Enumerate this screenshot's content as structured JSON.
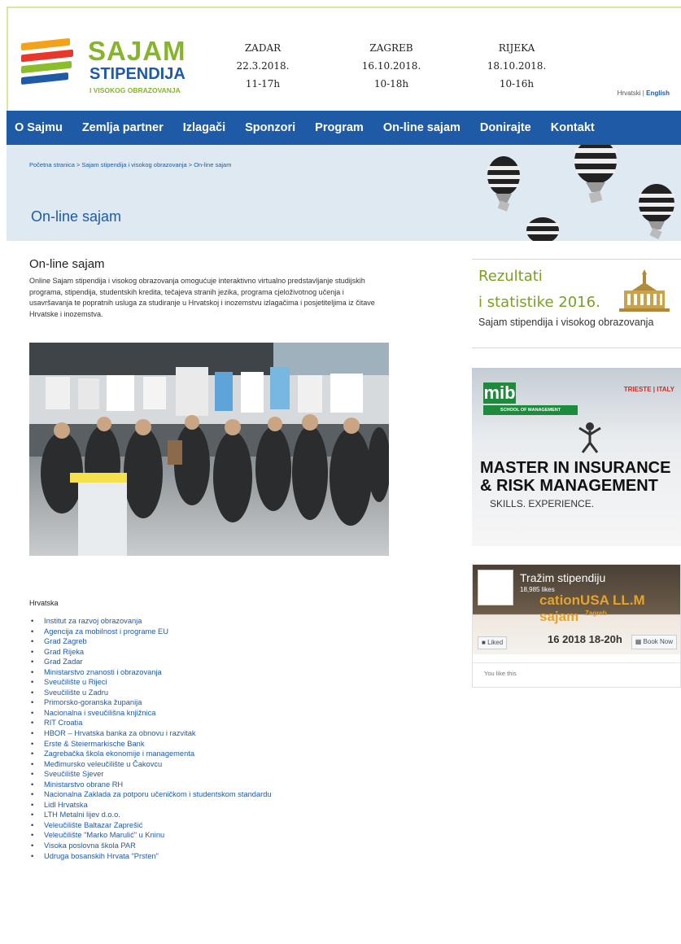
{
  "header": {
    "brand_line1": "SAJAM",
    "brand_line2": "STIPENDIJA",
    "brand_line3": "I VISOKOG OBRAZOVANJA",
    "events": [
      {
        "city": "ZADAR",
        "date": "22.3.2018.",
        "time": "11-17h"
      },
      {
        "city": "ZAGREB",
        "date": "16.10.2018.",
        "time": "10-18h"
      },
      {
        "city": "RIJEKA",
        "date": "18.10.2018.",
        "time": "10-16h"
      }
    ],
    "lang_hr": "Hrvatski",
    "lang_sep": "|",
    "lang_en": "English"
  },
  "nav": [
    "O Sajmu",
    "Zemlja partner",
    "Izlagači",
    "Sponzori",
    "Program",
    "On-line sajam",
    "Donirajte",
    "Kontakt"
  ],
  "banner": {
    "breadcrumb": "Početna stranica > Sajam stipendija i visokog obrazovanja > On-line sajam",
    "title": "On-line sajam"
  },
  "main": {
    "heading": "On-line sajam",
    "intro": "Online Sajam stipendija i visokog obrazovanja omogućuje interaktivno virtualno predstavljanje studijskih programa, stipendija, studentskih kredita, tečajeva stranih jezika, programa cjeloživotnog učenja i usavršavanja te popratnih usluga za studiranje u Hrvatskoj i inozemstvu izlagačima i posjetiteljima iz čitave Hrvatske i inozemstva.",
    "section_title": "Hrvatska",
    "links": [
      "Institut za razvoj obrazovanja",
      "Agencija za mobilnost i programe EU",
      "Grad Zagreb",
      "Grad Rijeka",
      "Grad Zadar",
      "Ministarstvo znanosti i obrazovanja",
      "Sveučilište u Rijeci",
      "Sveučilište u Zadru",
      "Primorsko-goranska županija",
      "Nacionalna i sveučilišna knjižnica",
      "RIT Croatia",
      "HBOR – Hrvatska banka za obnovu i razvitak",
      "Erste & Steiermarkische Bank",
      "Zagrebačka škola ekonomije i managementa",
      "Međimursko veleučilište u Čakovcu",
      "Sveučilište Sjever",
      "Ministarstvo obrane RH",
      "Nacionalna Zaklada za potporu učeničkom i studentskom standardu",
      "Lidl Hrvatska",
      "LTH Metalni lijev d.o.o.",
      "Veleučilište Baltazar Zaprešić",
      "Veleučilište \"Marko Marulić\" u Kninu",
      "Visoka poslovna škola PAR",
      "Udruga bosanskih Hrvata \"Prsten\""
    ]
  },
  "sidebar": {
    "results_line1": "Rezultati",
    "results_line2": "i statistike 2016.",
    "results_sub": "Sajam stipendija i visokog obrazovanja",
    "ad": {
      "logo": "mib",
      "school": "SCHOOL OF MANAGEMENT",
      "location": "TRIESTE | ITALY",
      "line1": "MASTER IN INSURANCE",
      "line2": "& RISK MANAGEMENT",
      "line3": "SKILLS. EXPERIENCE."
    },
    "fb": {
      "page_name": "Tražim stipendiju",
      "likes": "18,985 likes",
      "cover_text": "cationUSA LL.M sajam",
      "cover_city": "Zagreb",
      "liked_btn": "Liked",
      "cover_date": "16 2018 18-20h",
      "book_btn": "Book Now",
      "you_like": "You like this"
    }
  },
  "colors": {
    "brand_blue": "#1f5aa6",
    "brand_green": "#86b52b",
    "banner_bg": "#dfe9f2"
  }
}
